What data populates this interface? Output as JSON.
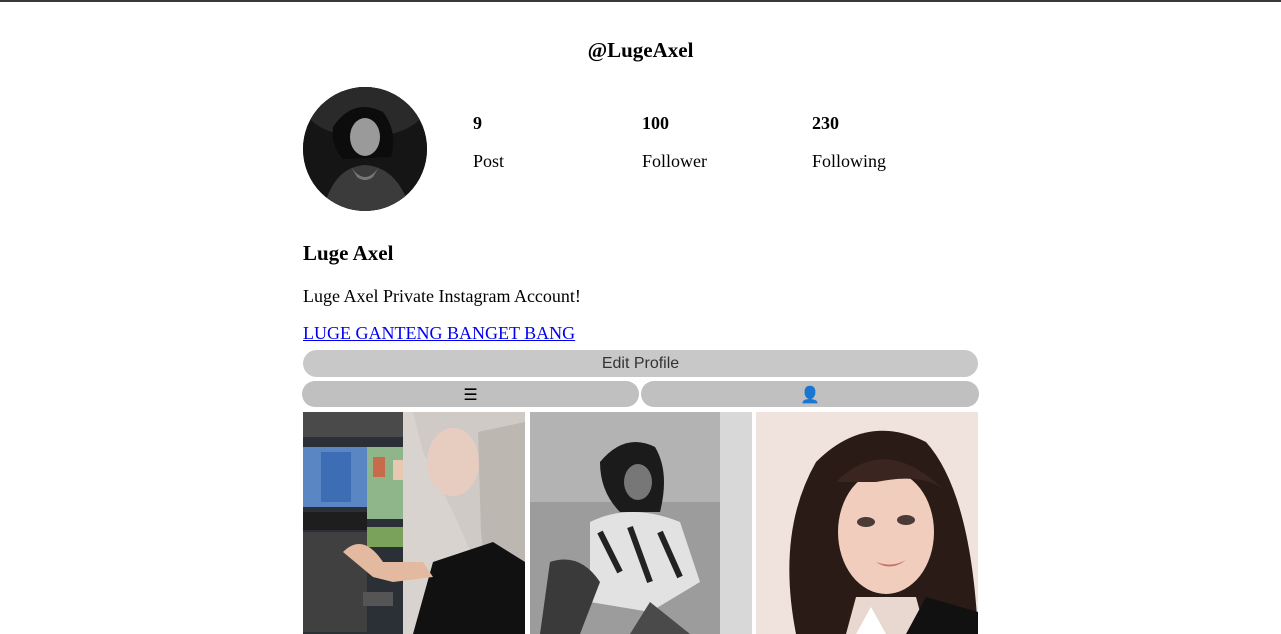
{
  "profile": {
    "username": "@LugeAxel",
    "display_name": "Luge Axel",
    "bio": "Luge Axel Private Instagram Account!",
    "link_text": "LUGE GANTENG BANGET BANG"
  },
  "stats": [
    {
      "value": "9",
      "label": "Post"
    },
    {
      "value": "100",
      "label": "Follower"
    },
    {
      "value": "230",
      "label": "Following"
    }
  ],
  "buttons": {
    "edit_profile": "Edit Profile"
  },
  "tabs": {
    "grid_icon": "☰",
    "tagged_icon": "👤"
  },
  "icons": {
    "grid_tab": "hamburger-menu-icon",
    "tagged_tab": "person-icon"
  },
  "colors": {
    "button_bg": "#c8c8c8",
    "tab_bg": "#c0c0c0",
    "link": "#0000ee"
  }
}
